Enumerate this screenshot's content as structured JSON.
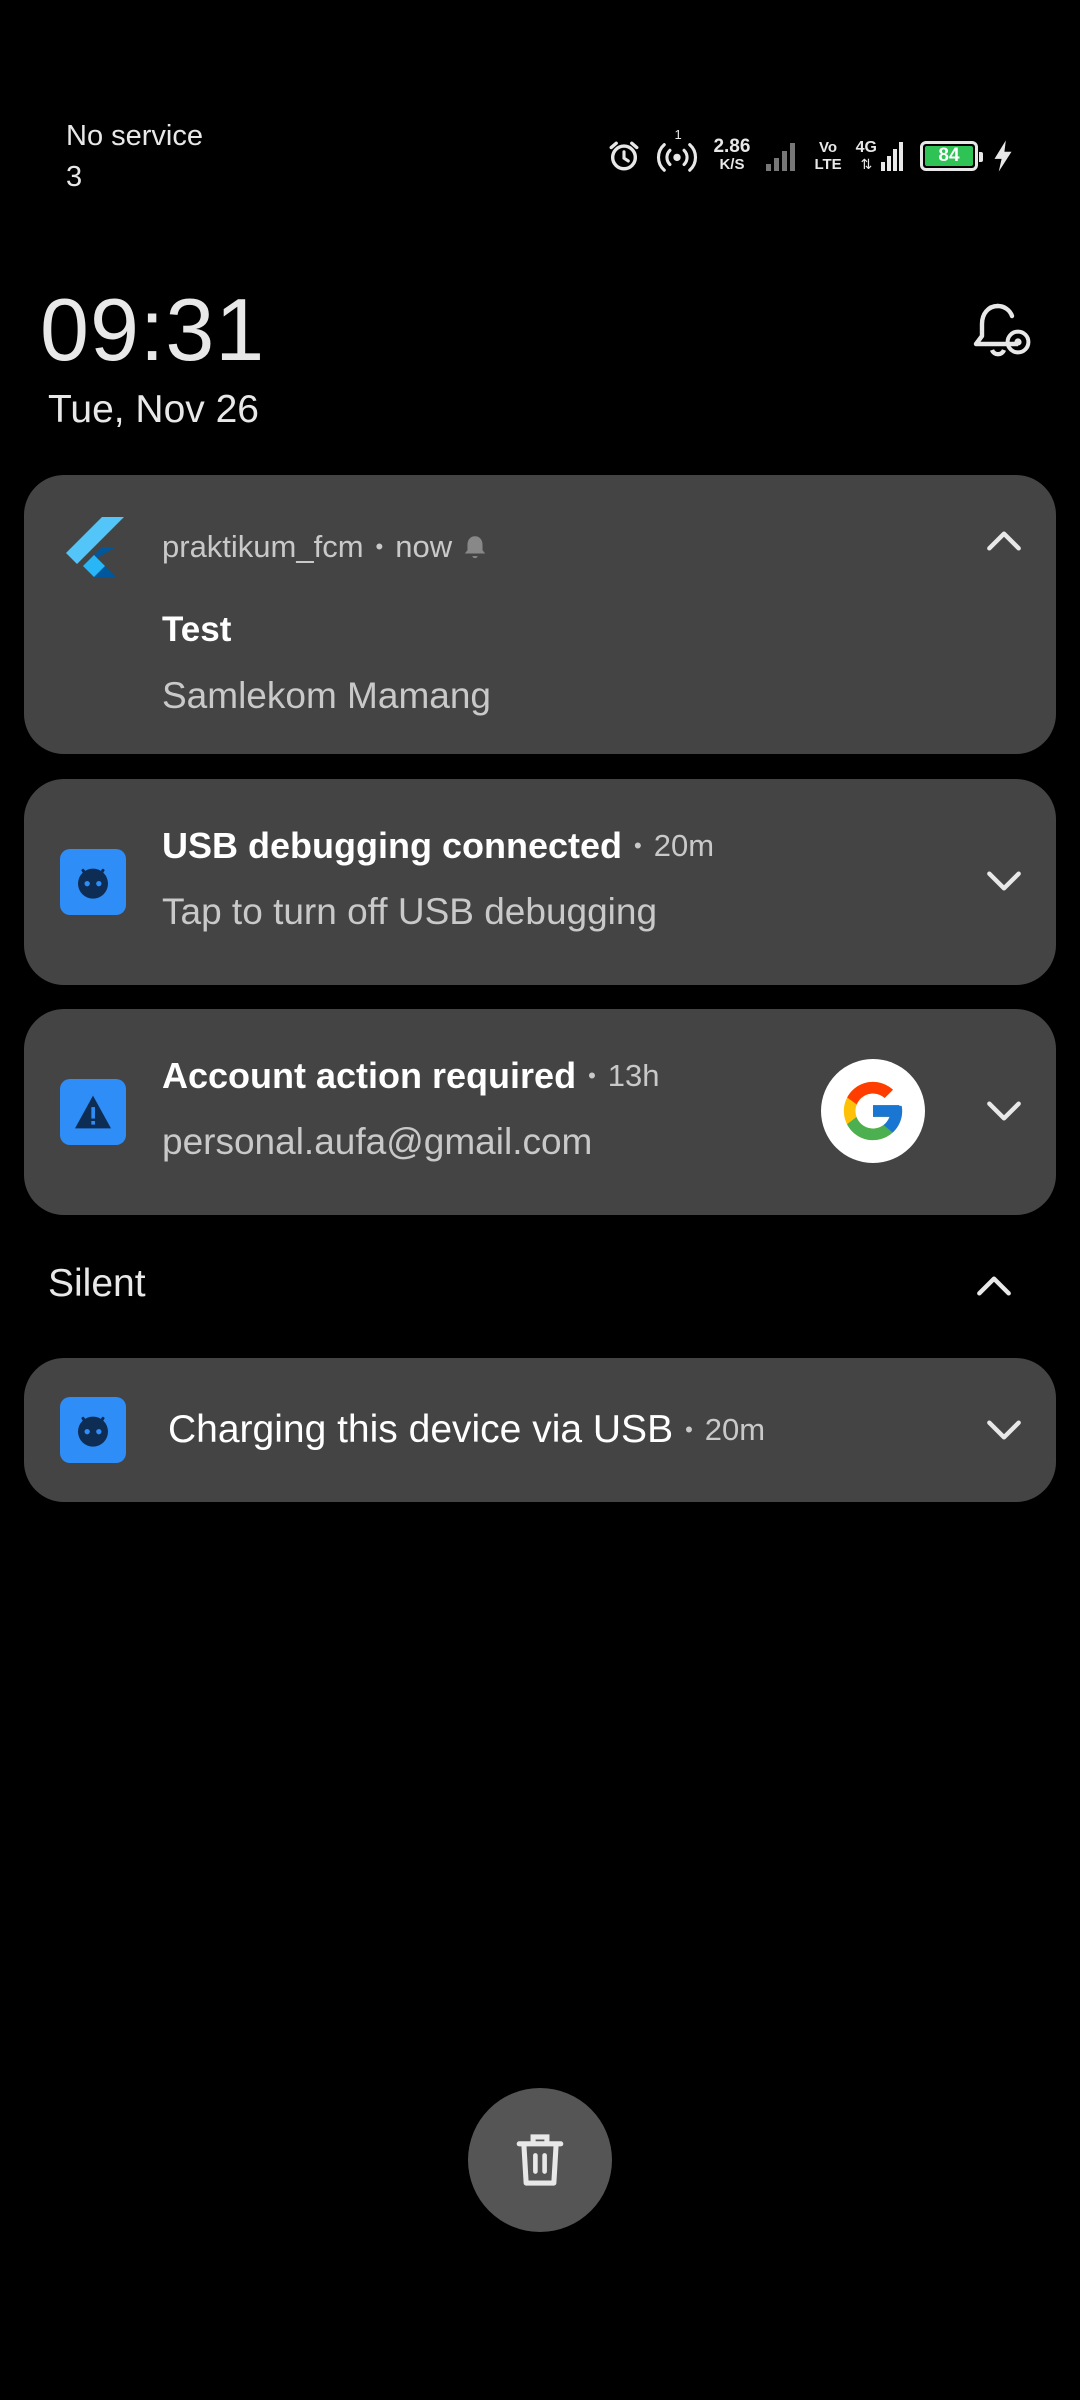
{
  "status_bar": {
    "carrier_line1": "No service",
    "carrier_line2": "3",
    "hotspot_badge": "1",
    "net_speed_value": "2.86",
    "net_speed_unit": "K/S",
    "volte_top": "Vo",
    "volte_bottom": "LTE",
    "network_type": "4G",
    "battery_level": "84",
    "icons": [
      "alarm-icon",
      "hotspot-icon",
      "signal-icon",
      "volte-icon",
      "4g-signal-icon",
      "battery-icon",
      "charging-bolt-icon"
    ],
    "battery_color": "#2fc255"
  },
  "clock": {
    "time": "09:31",
    "date": "Tue, Nov 26"
  },
  "notifications": [
    {
      "app": "praktikum_fcm",
      "time": "now",
      "title": "Test",
      "body": "Samlekom Mamang",
      "icon": "flutter-icon",
      "expanded": true
    },
    {
      "title": "USB debugging connected",
      "time": "20m",
      "body": "Tap to turn off USB debugging",
      "icon": "android-system-icon"
    },
    {
      "title": "Account action required",
      "time": "13h",
      "body": "personal.aufa@gmail.com",
      "icon": "warning-icon",
      "avatar": "google-logo"
    }
  ],
  "silent": {
    "header": "Silent",
    "items": [
      {
        "title": "Charging this device via USB",
        "time": "20m",
        "icon": "android-system-icon"
      }
    ]
  },
  "clear_all": {
    "icon": "trash-icon"
  },
  "colors": {
    "card_bg": "#444444",
    "app_badge": "#2e8df7",
    "background": "#000000"
  }
}
